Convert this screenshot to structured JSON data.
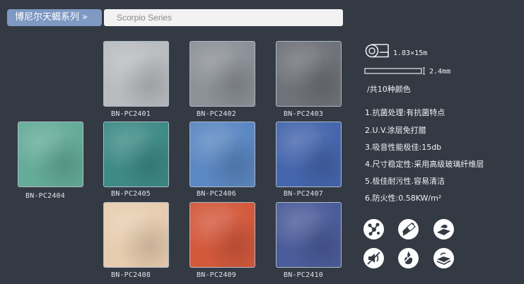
{
  "header": {
    "series_tab_label": "博尼尔天蝎系列 »",
    "series_name": "Scorpio Series"
  },
  "swatches": [
    {
      "code": "BN-PC2401",
      "color": "#b9bcbf"
    },
    {
      "code": "BN-PC2402",
      "color": "#8c9197"
    },
    {
      "code": "BN-PC2403",
      "color": "#6f7278"
    },
    {
      "code": "BN-PC2404",
      "color": "#64ab98"
    },
    {
      "code": "BN-PC2405",
      "color": "#3e8b86"
    },
    {
      "code": "BN-PC2406",
      "color": "#5b87c2"
    },
    {
      "code": "BN-PC2407",
      "color": "#4566ad"
    },
    {
      "code": "BN-PC2408",
      "color": "#e7cdaf"
    },
    {
      "code": "BN-PC2409",
      "color": "#d3593c"
    },
    {
      "code": "BN-PC2410",
      "color": "#4b5c9a"
    }
  ],
  "specs": {
    "roll_size": "1.83×15m",
    "thickness": "2.4mm",
    "color_count": "/共10种颜色"
  },
  "features": [
    "1.抗菌处理:有抗菌特点",
    "2.U.V.涂层免打腊",
    "3.吸音性能极佳:15db",
    "4.尺寸稳定性:采用高级玻璃纤维层",
    "5.极佳耐污性.容易清洁",
    "6.防火性:0.58KW/m²"
  ],
  "icons": [
    "molecule-icon",
    "pill-capsule-icon",
    "floor-cleaning-icon",
    "no-sound-icon",
    "fire-safety-icon",
    "flooring-layers-icon"
  ]
}
